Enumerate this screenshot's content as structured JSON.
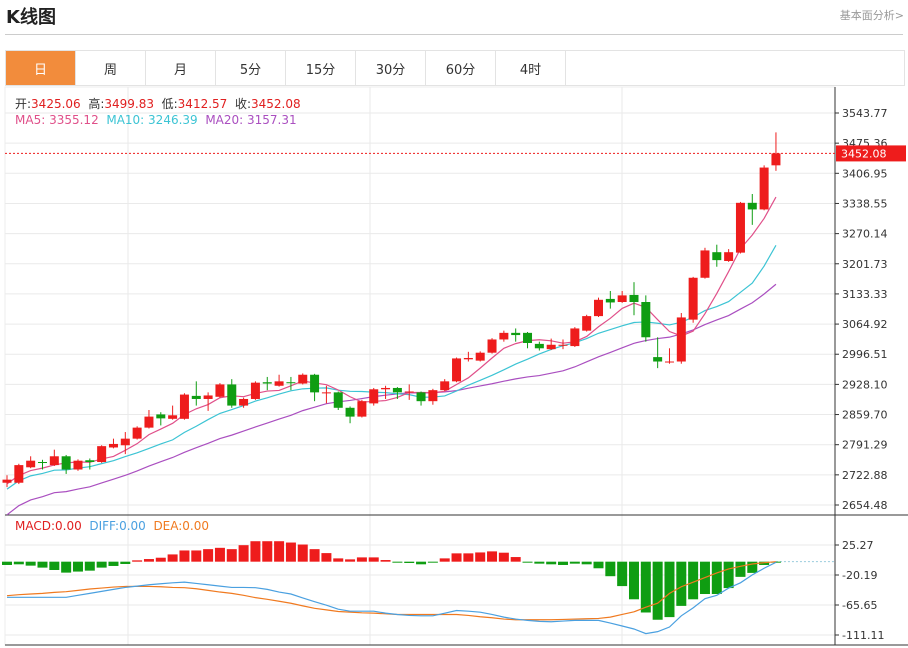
{
  "header": {
    "title": "K线图",
    "link": "基本面分析>"
  },
  "tabs": [
    {
      "label": "日",
      "active": true
    },
    {
      "label": "周"
    },
    {
      "label": "月"
    },
    {
      "label": "5分"
    },
    {
      "label": "15分"
    },
    {
      "label": "30分"
    },
    {
      "label": "60分"
    },
    {
      "label": "4时"
    }
  ],
  "ohlc": {
    "open_label": "开:",
    "open": "3425.06",
    "high_label": "高:",
    "high": "3499.83",
    "low_label": "低:",
    "low": "3412.57",
    "close_label": "收:",
    "close": "3452.08"
  },
  "ma": {
    "ma5_label": "MA5:",
    "ma5": "3355.12",
    "ma10_label": "MA10:",
    "ma10": "3246.39",
    "ma20_label": "MA20:",
    "ma20": "3157.31"
  },
  "macd_info": {
    "macd": "MACD:0.00",
    "diff": "DIFF:0.00",
    "dea": "DEA:0.00"
  },
  "colors": {
    "up": "#ee1c1c",
    "down": "#0f9d12",
    "accent": "#f28c3c",
    "ma5": "#e0508a",
    "ma10": "#3cc4d4",
    "ma20": "#aa4fc0",
    "diff": "#4aa0e0",
    "dea": "#f07a20"
  },
  "chart_data": [
    {
      "type": "candlestick",
      "y_ticks": [
        "3543.77",
        "3475.36",
        "3406.95",
        "3338.55",
        "3270.14",
        "3201.73",
        "3133.33",
        "3064.92",
        "2996.51",
        "2928.10",
        "2859.70",
        "2791.29",
        "2722.88",
        "2654.48"
      ],
      "ylim": [
        2654.48,
        3543.77
      ],
      "last_price": "3452.08",
      "candles": [
        [
          2705,
          2712,
          2722,
          2695
        ],
        [
          2705,
          2745,
          2748,
          2702
        ],
        [
          2740,
          2755,
          2765,
          2738
        ],
        [
          2752,
          2750,
          2757,
          2735
        ],
        [
          2745,
          2765,
          2780,
          2743
        ],
        [
          2765,
          2735,
          2768,
          2725
        ],
        [
          2735,
          2755,
          2758,
          2732
        ],
        [
          2756,
          2752,
          2760,
          2735
        ],
        [
          2752,
          2788,
          2790,
          2750
        ],
        [
          2785,
          2793,
          2805,
          2783
        ],
        [
          2790,
          2805,
          2820,
          2770
        ],
        [
          2805,
          2830,
          2833,
          2803
        ],
        [
          2830,
          2855,
          2870,
          2828
        ],
        [
          2860,
          2851,
          2865,
          2835
        ],
        [
          2850,
          2858,
          2880,
          2848
        ],
        [
          2850,
          2905,
          2908,
          2848
        ],
        [
          2902,
          2895,
          2935,
          2880
        ],
        [
          2895,
          2903,
          2910,
          2868
        ],
        [
          2900,
          2928,
          2931,
          2898
        ],
        [
          2928,
          2880,
          2940,
          2875
        ],
        [
          2880,
          2895,
          2898,
          2875
        ],
        [
          2895,
          2932,
          2935,
          2893
        ],
        [
          2933,
          2930,
          2945,
          2915
        ],
        [
          2925,
          2935,
          2950,
          2923
        ],
        [
          2933,
          2932,
          2945,
          2915
        ],
        [
          2930,
          2950,
          2953,
          2928
        ],
        [
          2950,
          2910,
          2952,
          2890
        ],
        [
          2908,
          2910,
          2925,
          2885
        ],
        [
          2910,
          2875,
          2912,
          2870
        ],
        [
          2875,
          2855,
          2878,
          2840
        ],
        [
          2855,
          2890,
          2893,
          2853
        ],
        [
          2885,
          2917,
          2920,
          2880
        ],
        [
          2917,
          2920,
          2925,
          2895
        ],
        [
          2920,
          2910,
          2922,
          2895
        ],
        [
          2910,
          2912,
          2928,
          2893
        ],
        [
          2910,
          2890,
          2912,
          2880
        ],
        [
          2890,
          2915,
          2918,
          2882
        ],
        [
          2915,
          2935,
          2940,
          2913
        ],
        [
          2935,
          2987,
          2989,
          2933
        ],
        [
          2985,
          2988,
          3002,
          2980
        ],
        [
          2982,
          3000,
          3003,
          2980
        ],
        [
          3000,
          3030,
          3033,
          2998
        ],
        [
          3030,
          3045,
          3050,
          3025
        ],
        [
          3045,
          3040,
          3055,
          3025
        ],
        [
          3045,
          3022,
          3047,
          3010
        ],
        [
          3020,
          3010,
          3025,
          3005
        ],
        [
          3008,
          3018,
          3032,
          3006
        ],
        [
          3017,
          3018,
          3030,
          3008
        ],
        [
          3015,
          3055,
          3058,
          3013
        ],
        [
          3050,
          3083,
          3086,
          3048
        ],
        [
          3083,
          3120,
          3125,
          3081
        ],
        [
          3122,
          3114,
          3140,
          3100
        ],
        [
          3115,
          3130,
          3140,
          3113
        ],
        [
          3131,
          3115,
          3160,
          3085
        ],
        [
          3115,
          3035,
          3130,
          3025
        ],
        [
          2990,
          2980,
          3035,
          2965
        ],
        [
          2978,
          2980,
          3010,
          2975
        ],
        [
          2980,
          3080,
          3090,
          2975
        ],
        [
          3075,
          3170,
          3172,
          3068
        ],
        [
          3170,
          3232,
          3238,
          3168
        ],
        [
          3228,
          3210,
          3245,
          3195
        ],
        [
          3208,
          3228,
          3235,
          3206
        ],
        [
          3227,
          3340,
          3342,
          3225
        ],
        [
          3340,
          3325,
          3360,
          3290
        ],
        [
          3325,
          3420,
          3425,
          3323
        ],
        [
          3425.06,
          3452.08,
          3499.83,
          3412.57
        ]
      ]
    },
    {
      "type": "macd",
      "y_ticks": [
        "25.27",
        "-20.19",
        "-65.65",
        "-111.11"
      ],
      "ylim": [
        -111.11,
        25.27
      ],
      "histogram": [
        -5,
        -4,
        -6,
        -9,
        -12.6,
        -16.6,
        -15,
        -13.6,
        -9,
        -6.5,
        -3.5,
        2,
        4,
        6,
        11,
        17,
        17,
        19,
        21,
        19,
        25,
        31,
        31,
        31,
        29,
        26,
        19,
        13,
        5,
        3.5,
        6.5,
        6.5,
        2.5,
        -1,
        -2,
        -4,
        -1,
        5,
        12.6,
        12.6,
        14,
        15.6,
        13.6,
        7,
        -0.5,
        -3,
        -4,
        -5,
        -3,
        -4,
        -10,
        -22,
        -37,
        -57,
        -77,
        -88,
        -84,
        -67,
        -57,
        -49,
        -49,
        -40,
        -23,
        -17,
        -5,
        -1
      ],
      "diff": [
        -54,
        -54,
        -54,
        -54,
        -54,
        -54,
        -51,
        -48,
        -45,
        -42,
        -39,
        -37,
        -35,
        -33.5,
        -32,
        -31,
        -33,
        -35,
        -37,
        -39,
        -39,
        -39.4,
        -42,
        -46,
        -49,
        -55,
        -60.6,
        -66,
        -72,
        -75,
        -75,
        -75,
        -78,
        -80,
        -81.5,
        -82,
        -82,
        -78,
        -74,
        -75,
        -76.5,
        -80,
        -84,
        -87,
        -89,
        -90.5,
        -91,
        -90,
        -89,
        -89,
        -89,
        -93,
        -97.5,
        -102,
        -109,
        -106,
        -99,
        -82,
        -70,
        -56,
        -51,
        -40,
        -32,
        -20,
        -10,
        -1
      ],
      "dea": [
        -51.5,
        -50,
        -49,
        -48,
        -46.5,
        -45.5,
        -43.5,
        -41.4,
        -40,
        -38.5,
        -37.5,
        -37.4,
        -37.5,
        -38,
        -39,
        -39.4,
        -41,
        -43.5,
        -46,
        -48,
        -51,
        -54.5,
        -57,
        -60,
        -63,
        -67,
        -70.7,
        -73,
        -75.5,
        -76.5,
        -77.5,
        -78,
        -79,
        -80,
        -80,
        -80,
        -80,
        -80,
        -80,
        -81.5,
        -83.5,
        -85,
        -87,
        -88,
        -88,
        -88,
        -88,
        -87.5,
        -87,
        -86.5,
        -86,
        -84,
        -80,
        -76,
        -69,
        -63,
        -48,
        -38,
        -31,
        -24,
        -17,
        -11,
        -7,
        -3.5,
        -1.5,
        0
      ]
    }
  ]
}
